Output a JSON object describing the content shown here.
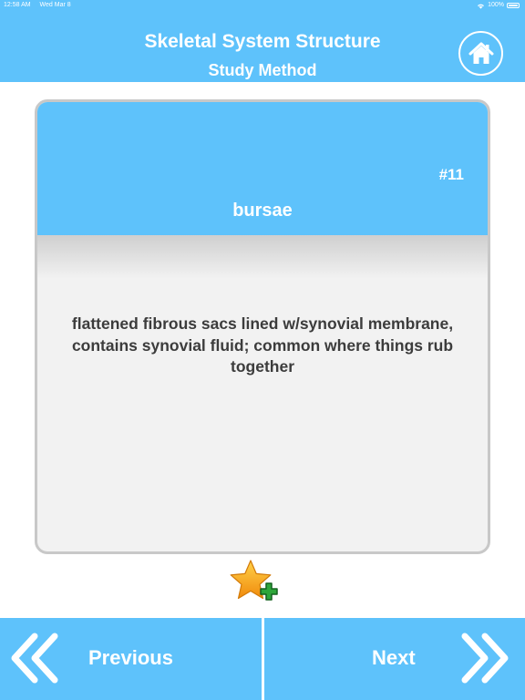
{
  "status_bar": {
    "time": "12:58 AM",
    "date": "Wed Mar 8",
    "battery": "100%"
  },
  "header": {
    "title": "Skeletal System Structure",
    "subtitle": "Study Method"
  },
  "card": {
    "number": "#11",
    "term": "bursae",
    "definition": "flattened fibrous sacs lined w/synovial membrane, contains synovial fluid; common where things rub together"
  },
  "footer": {
    "previous_label": "Previous",
    "next_label": "Next"
  },
  "icons": {
    "home": "home-icon",
    "favorite": "star-plus-icon",
    "previous": "double-chevron-left-icon",
    "next": "double-chevron-right-icon"
  },
  "colors": {
    "accent": "#5ec2fb",
    "card_border": "#c8c8c8",
    "card_body": "#f2f2f2",
    "definition_text": "#3c3c3c",
    "star": "#f7a91b",
    "plus": "#2ea63a"
  }
}
